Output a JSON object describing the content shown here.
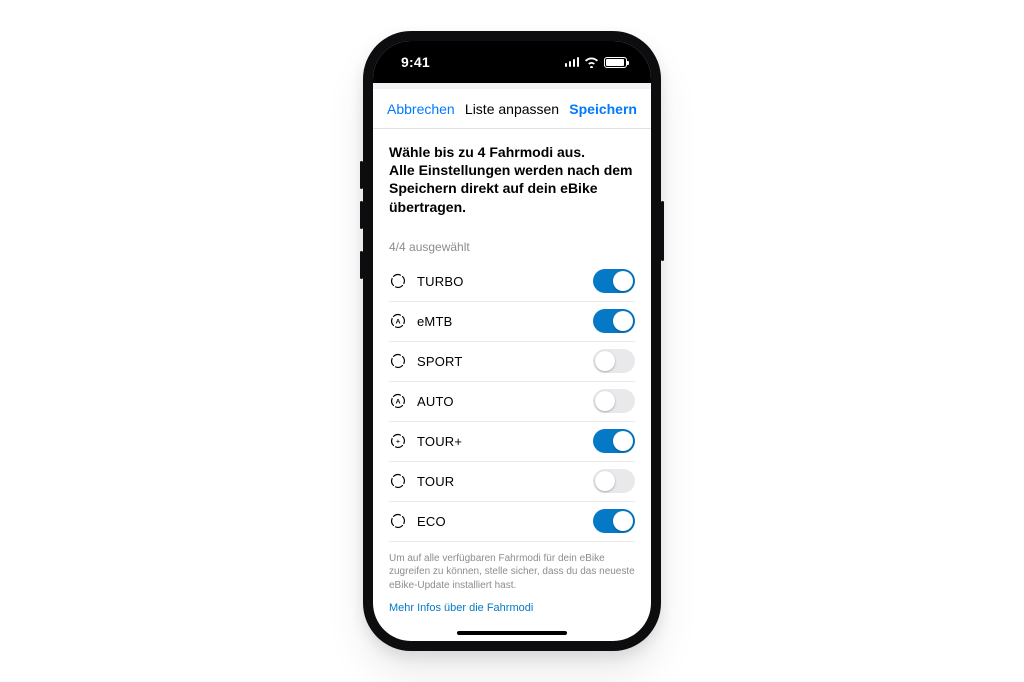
{
  "status": {
    "time": "9:41"
  },
  "sheet": {
    "cancel": "Abbrechen",
    "title": "Liste anpassen",
    "save": "Speichern"
  },
  "headline": "Wähle bis zu 4 Fahrmodi aus.\nAlle Einstellungen werden nach dem Speichern direkt auf dein eBike übertragen.",
  "counter": "4/4 ausgewählt",
  "modes": [
    {
      "key": "turbo",
      "label": "TURBO",
      "on": true,
      "glyph": ""
    },
    {
      "key": "emtb",
      "label": "eMTB",
      "on": true,
      "glyph": "A"
    },
    {
      "key": "sport",
      "label": "SPORT",
      "on": false,
      "glyph": ""
    },
    {
      "key": "auto",
      "label": "AUTO",
      "on": false,
      "glyph": "A"
    },
    {
      "key": "tourplus",
      "label": "TOUR+",
      "on": true,
      "glyph": "+"
    },
    {
      "key": "tour",
      "label": "TOUR",
      "on": false,
      "glyph": ""
    },
    {
      "key": "eco",
      "label": "ECO",
      "on": true,
      "glyph": ""
    }
  ],
  "footnote": "Um auf alle verfügbaren Fahrmodi für dein eBike zugreifen zu können, stelle sicher, dass du das neueste eBike-Update installiert hast.",
  "learn_more": "Mehr Infos über die Fahrmodi",
  "colors": {
    "accent": "#0579c6",
    "ios_blue": "#007aff"
  }
}
